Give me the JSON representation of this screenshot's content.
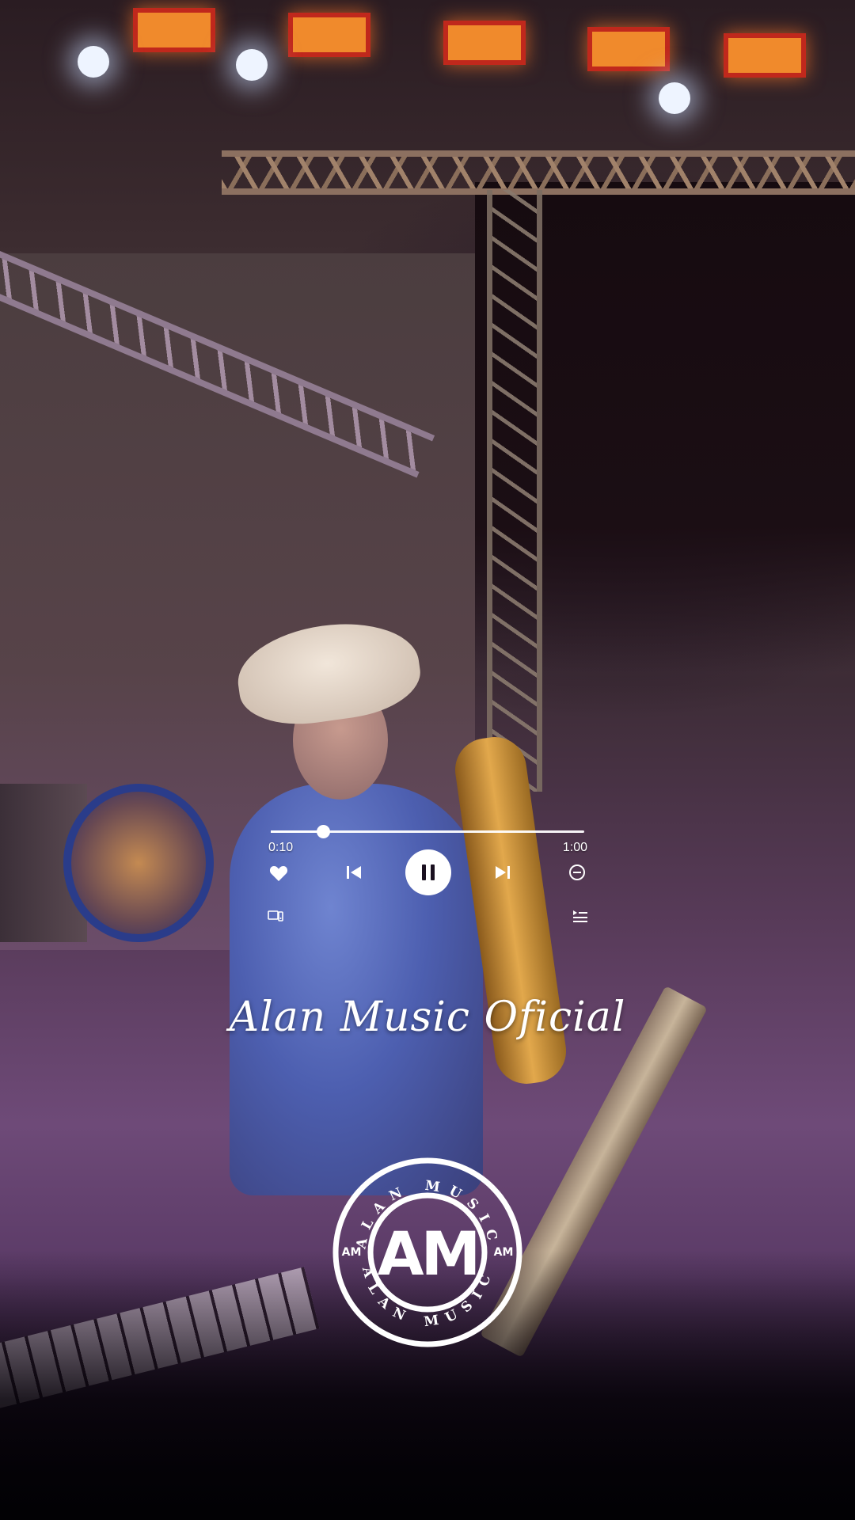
{
  "player": {
    "elapsed": "0:10",
    "total": "1:00",
    "progress_fraction": 0.167
  },
  "icons": {
    "like": "heart-icon",
    "previous": "skip-previous-icon",
    "play_pause": "pause-icon",
    "next": "skip-next-icon",
    "remove": "minus-circle-icon",
    "device": "cast-device-icon",
    "queue": "queue-list-icon"
  },
  "title": "Alan Music Oficial",
  "logo": {
    "ring_top": "ALAN MUSIC",
    "ring_bottom": "ALAN MUSIC",
    "monogram": "AM",
    "side_left": "AM",
    "side_right": "AM"
  },
  "colors": {
    "overlay_text": "#ffffff",
    "play_button_bg": "#ffffff"
  }
}
